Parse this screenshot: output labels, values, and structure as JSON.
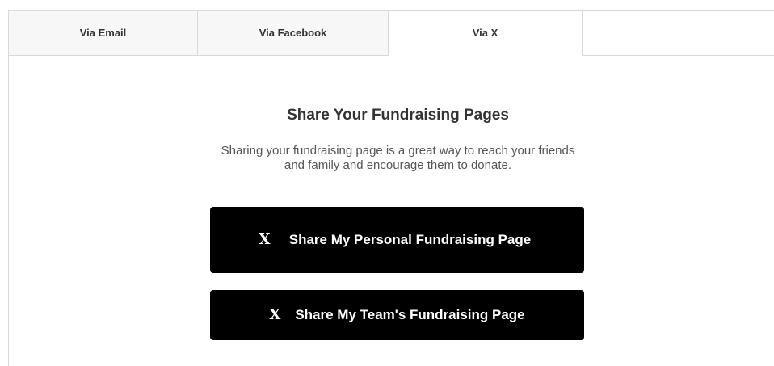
{
  "tabs": [
    {
      "label": "Via Email",
      "active": false
    },
    {
      "label": "Via Facebook",
      "active": false
    },
    {
      "label": "Via X",
      "active": true
    }
  ],
  "main": {
    "heading": "Share Your Fundraising Pages",
    "description": "Sharing your fundraising page is a great way to reach your friends and family and encourage them to donate.",
    "buttons": [
      {
        "icon": "x-logo-icon",
        "icon_glyph": "X",
        "label": "Share My Personal Fundraising Page"
      },
      {
        "icon": "x-logo-icon",
        "icon_glyph": "X",
        "label": "Share My Team's Fundraising Page"
      }
    ]
  },
  "colors": {
    "button_bg": "#000000",
    "button_text": "#ffffff",
    "tab_inactive_bg": "#f7f7f7",
    "border": "#d9d9d9"
  }
}
